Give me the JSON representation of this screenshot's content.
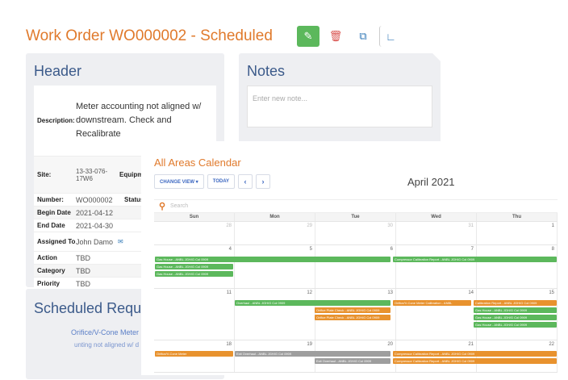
{
  "work_order": {
    "title": "Work Order WO000002 - Scheduled",
    "header_title": "Header",
    "description_label": "Description:",
    "description": "Meter accounting not aligned w/ downstream. Check and Recalibrate",
    "site_label": "Site:",
    "site": "13-33-076-17W6",
    "equipment_label": "Equipm",
    "status_label": "Status:",
    "fields": [
      {
        "label": "Number:",
        "value": "WO000002"
      },
      {
        "label": "Begin Date",
        "value": "2021-04-12"
      },
      {
        "label": "End Date",
        "value": "2021-04-30"
      }
    ],
    "assigned_label": "Assigned To",
    "assigned_value": "John Damo",
    "fields2": [
      {
        "label": "Action",
        "value": "TBD"
      },
      {
        "label": "Category",
        "value": "TBD"
      },
      {
        "label": "Priority",
        "value": "TBD"
      }
    ],
    "notes_title": "Notes",
    "notes_placeholder": "Enter new note...",
    "scheduled_title": "Scheduled Reque",
    "scheduled_link": "Orifice/V-Cone Meter",
    "scheduled_link2": "unting not aligned w/ d",
    "icons": [
      "pencil-icon",
      "trash-icon",
      "copy-icon",
      "ruler-icon"
    ],
    "accent": "#e07a2c",
    "heading_color": "#3b5a8a"
  },
  "calendar": {
    "title": "All Areas Calendar",
    "change_view": "CHANGE VIEW ▾",
    "today": "TODAY",
    "prev": "‹",
    "next": "›",
    "month": "April 2021",
    "search_placeholder": "Search",
    "days_of_week": [
      "Sun",
      "Mon",
      "Tue",
      "Wed",
      "Thu"
    ],
    "weeks": [
      {
        "days": [
          {
            "n": "28",
            "dim": true
          },
          {
            "n": "29",
            "dim": true
          },
          {
            "n": "30",
            "dim": true
          },
          {
            "n": "31",
            "dim": true
          },
          {
            "n": "1",
            "dim": false
          }
        ]
      },
      {
        "days": [
          {
            "n": "4",
            "dim": false
          },
          {
            "n": "5",
            "dim": false
          },
          {
            "n": "6",
            "dim": false
          },
          {
            "n": "7",
            "dim": false
          },
          {
            "n": "8",
            "dim": false
          }
        ]
      },
      {
        "days": [
          {
            "n": "11",
            "dim": false
          },
          {
            "n": "12",
            "dim": false
          },
          {
            "n": "13",
            "dim": false
          },
          {
            "n": "14",
            "dim": false
          },
          {
            "n": "15",
            "dim": false
          }
        ]
      },
      {
        "days": [
          {
            "n": "18",
            "dim": false
          },
          {
            "n": "19",
            "dim": false
          },
          {
            "n": "20",
            "dim": false
          },
          {
            "n": "21",
            "dim": false
          },
          {
            "n": "22",
            "dim": false
          }
        ]
      }
    ],
    "event_labels": {
      "gas_house": "Gas House - ANBL JGH/G Col 0909",
      "compressor": "Compressor Calibration Report - ANBL JGH/G Col 0909",
      "overhaul": "Overhaul - ANBL JGH/G Col 0909",
      "orifice": "Orifice Plate Check - ANBL JGH/G Col 0909",
      "meter": "Orifice/V-Cone Meter Calibration - ANBL",
      "calibration": "Calibration Report - ANBL JGH/G Col 0909",
      "cone": "Orifice/V-Cone Meter",
      "exit": "Exit Overhaul - ANBL JGH/G Col 0909"
    },
    "colors": {
      "green": "#5cb85c",
      "orange": "#e8922e",
      "grey": "#9e9e9e"
    }
  }
}
